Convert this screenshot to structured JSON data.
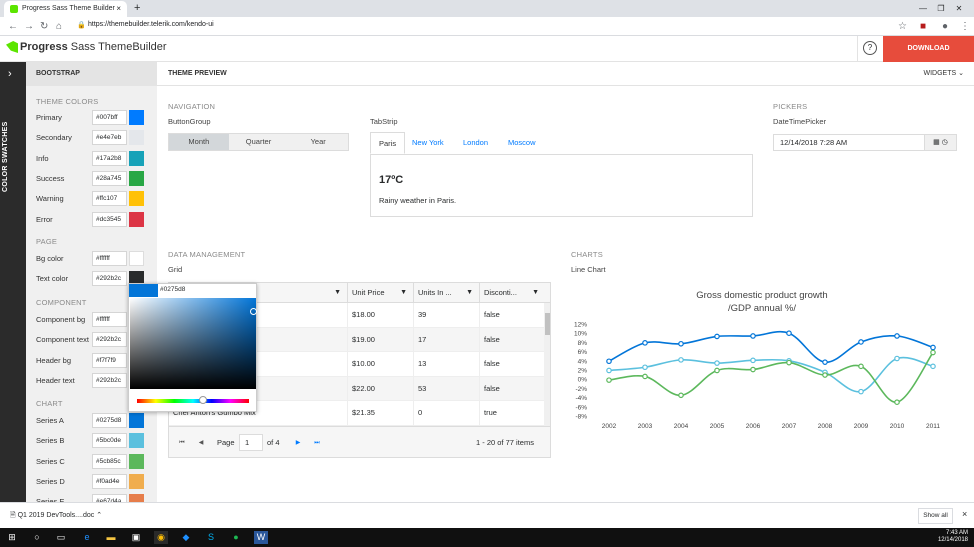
{
  "browser": {
    "tab_title": "Progress Sass Theme Builder",
    "url": "https://themebuilder.telerik.com/kendo-ui",
    "new_tab": "+",
    "tab_close": "×"
  },
  "header": {
    "logo_brand": "Progress",
    "logo_product": "Sass ThemeBuilder",
    "help": "?",
    "download_label": "DOWNLOAD"
  },
  "leftbar": {
    "vertical_label": "COLOR SWATCHES",
    "toggle": "›"
  },
  "sidebar": {
    "theme_name": "BOOTSTRAP",
    "sections": [
      {
        "title": "THEME COLORS",
        "items": [
          {
            "label": "Primary",
            "value": "#007bff",
            "color": "#007bff"
          },
          {
            "label": "Secondary",
            "value": "#e4e7eb",
            "color": "#e4e7eb"
          },
          {
            "label": "Info",
            "value": "#17a2b8",
            "color": "#17a2b8"
          },
          {
            "label": "Success",
            "value": "#28a745",
            "color": "#28a745"
          },
          {
            "label": "Warning",
            "value": "#ffc107",
            "color": "#ffc107"
          },
          {
            "label": "Error",
            "value": "#dc3545",
            "color": "#dc3545"
          }
        ]
      },
      {
        "title": "PAGE",
        "items": [
          {
            "label": "Bg color",
            "value": "#ffffff",
            "color": "#ffffff"
          },
          {
            "label": "Text color",
            "value": "#292b2c",
            "color": "#292b2c"
          }
        ]
      },
      {
        "title": "COMPONENT",
        "items": [
          {
            "label": "Component bg",
            "value": "#ffffff",
            "color": "#ffffff"
          },
          {
            "label": "Component text",
            "value": "#292b2c",
            "color": "#292b2c"
          },
          {
            "label": "Header bg",
            "value": "#f7f7f9",
            "color": "#f7f7f9"
          },
          {
            "label": "Header text",
            "value": "#292b2c",
            "color": "#292b2c"
          }
        ]
      },
      {
        "title": "CHART",
        "items": [
          {
            "label": "Series A",
            "value": "#0275d8",
            "color": "#0275d8"
          },
          {
            "label": "Series B",
            "value": "#5bc0de",
            "color": "#5bc0de"
          },
          {
            "label": "Series C",
            "value": "#5cb85c",
            "color": "#5cb85c"
          },
          {
            "label": "Series D",
            "value": "#f0ad4e",
            "color": "#f0ad4e"
          },
          {
            "label": "Series E",
            "value": "#e67d4a",
            "color": "#e67d4a"
          }
        ]
      }
    ]
  },
  "color_picker": {
    "hex": "#0275d8",
    "color": "#0275d8"
  },
  "preview": {
    "title": "THEME PREVIEW",
    "widgets_label": "WIDGETS",
    "navigation": {
      "section": "NAVIGATION",
      "buttongroup_title": "ButtonGroup",
      "buttons": [
        "Month",
        "Quarter",
        "Year"
      ],
      "selected": 0,
      "tabstrip_title": "TabStrip",
      "tabs": [
        "Paris",
        "New York",
        "London",
        "Moscow"
      ],
      "temperature": "17ºC",
      "weather": "Rainy weather in Paris."
    },
    "pickers": {
      "section": "PICKERS",
      "dtp_title": "DateTimePicker",
      "dtp_value": "12/14/2018 7:28 AM"
    },
    "data": {
      "section": "DATA MANAGEMENT",
      "grid_title": "Grid",
      "columns": [
        "Unit Price",
        "Units In ...",
        "Disconti..."
      ],
      "rows": [
        {
          "name": "",
          "price": "$18.00",
          "units": "39",
          "disc": "false"
        },
        {
          "name": "",
          "price": "$19.00",
          "units": "17",
          "disc": "false"
        },
        {
          "name": "",
          "price": "$10.00",
          "units": "13",
          "disc": "false"
        },
        {
          "name": "asoning",
          "price": "$22.00",
          "units": "53",
          "disc": "false"
        },
        {
          "name": "Chef Anton's Gumbo Mix",
          "price": "$21.35",
          "units": "0",
          "disc": "true"
        }
      ],
      "pager": {
        "page_label": "Page",
        "page": "1",
        "of": "of 4",
        "info": "1 - 20 of 77 items"
      }
    },
    "charts": {
      "section": "CHARTS",
      "title": "Line Chart"
    }
  },
  "chart_data": {
    "type": "line",
    "title": "Gross domestic product growth",
    "subtitle": "/GDP annual %/",
    "x": [
      "2002",
      "2003",
      "2004",
      "2005",
      "2006",
      "2007",
      "2008",
      "2009",
      "2010",
      "2011"
    ],
    "ylim": [
      -8,
      12
    ],
    "yticks": [
      "12%",
      "10%",
      "8%",
      "6%",
      "4%",
      "2%",
      "0%",
      "-2%",
      "-4%",
      "-6%",
      "-8%"
    ],
    "series": [
      {
        "color": "#0275d8",
        "values": [
          3.9,
          7.9,
          7.7,
          9.3,
          9.4,
          10.0,
          3.7,
          8.1,
          9.4,
          6.9
        ]
      },
      {
        "color": "#5bc0de",
        "values": [
          1.9,
          2.6,
          4.2,
          3.5,
          4.1,
          4.0,
          1.5,
          -2.7,
          4.5,
          2.8
        ]
      },
      {
        "color": "#5cb85c",
        "values": [
          -0.2,
          0.6,
          -3.5,
          1.9,
          2.1,
          3.6,
          0.9,
          2.8,
          -5.0,
          5.8
        ]
      }
    ]
  },
  "shelf": {
    "download_name": "Q1 2019 DevTools....doc",
    "show_all": "Show all",
    "close": "×"
  },
  "taskbar": {
    "time": "7:43 AM",
    "date": "12/14/2018"
  }
}
